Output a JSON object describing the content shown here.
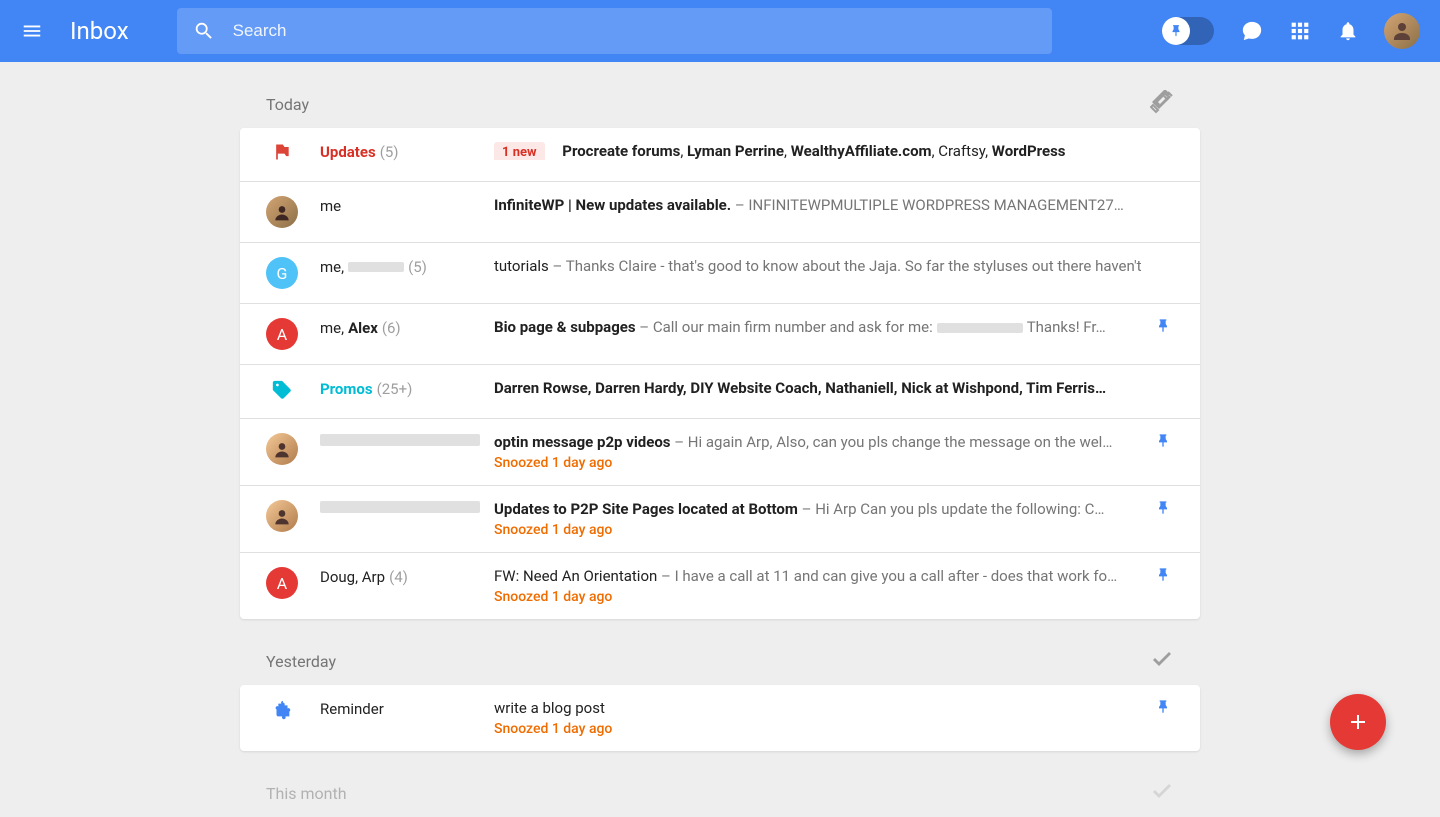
{
  "app_title": "Inbox",
  "search": {
    "placeholder": "Search"
  },
  "sections": [
    {
      "label": "Today"
    },
    {
      "label": "Yesterday"
    },
    {
      "label": "This month"
    }
  ],
  "today": {
    "updates": {
      "name": "Updates",
      "count": "(5)",
      "new_badge": "1 new",
      "senders_html": "<span class='b'>Procreate forums</span>, <span class='b'>Lyman Perrine</span>, <span class='b'>WealthyAffiliate.com</span>, Craftsy, <span class='b'>WordPress</span>"
    },
    "r1": {
      "sender": "me",
      "subject": "InfiniteWP | New updates available.",
      "preview": " – INFINITEWPMULTIPLE WORDPRESS MANAGEMENT27…"
    },
    "r2": {
      "sender_prefix": "me,",
      "count": "(5)",
      "subject_plain": "tutorials",
      "preview": " – Thanks Claire - that's good to know about the Jaja. So far the styluses out there haven't"
    },
    "r3": {
      "sender_parts": {
        "a": "me, ",
        "b": "Alex"
      },
      "count": "(6)",
      "subject": "Bio page & subpages",
      "preview_a": " – Call our main firm number and ask for me:",
      "preview_b": "Thanks! Fr…"
    },
    "promos": {
      "name": "Promos",
      "count": "(25+)",
      "senders": "Darren Rowse, Darren Hardy, DIY Website Coach, Nathaniell, Nick at Wishpond, Tim Ferris…"
    },
    "r4": {
      "subject": "optin message p2p videos",
      "preview": " – Hi again Arp, Also, can you pls change the message on the wel…",
      "snoozed": "Snoozed 1 day ago"
    },
    "r5": {
      "subject": "Updates to P2P Site Pages located at Bottom",
      "preview": " – Hi Arp Can you pls update the following: C…",
      "snoozed": "Snoozed 1 day ago"
    },
    "r6": {
      "sender": "Doug, Arp",
      "count": "(4)",
      "subject_plain": "FW: Need An Orientation",
      "preview": " – I have a call at 11 and can give you a call after - does that work fo…",
      "snoozed": "Snoozed 1 day ago"
    }
  },
  "yesterday": {
    "reminder": {
      "label": "Reminder",
      "text": "write a blog post",
      "snoozed": "Snoozed 1 day ago"
    }
  },
  "colors": {
    "avatar_G": "#4fc3f7",
    "avatar_A": "#e53935",
    "avatar_face": "linear-gradient(135deg,#f4c997 0%, #b07a4a 100%)"
  }
}
